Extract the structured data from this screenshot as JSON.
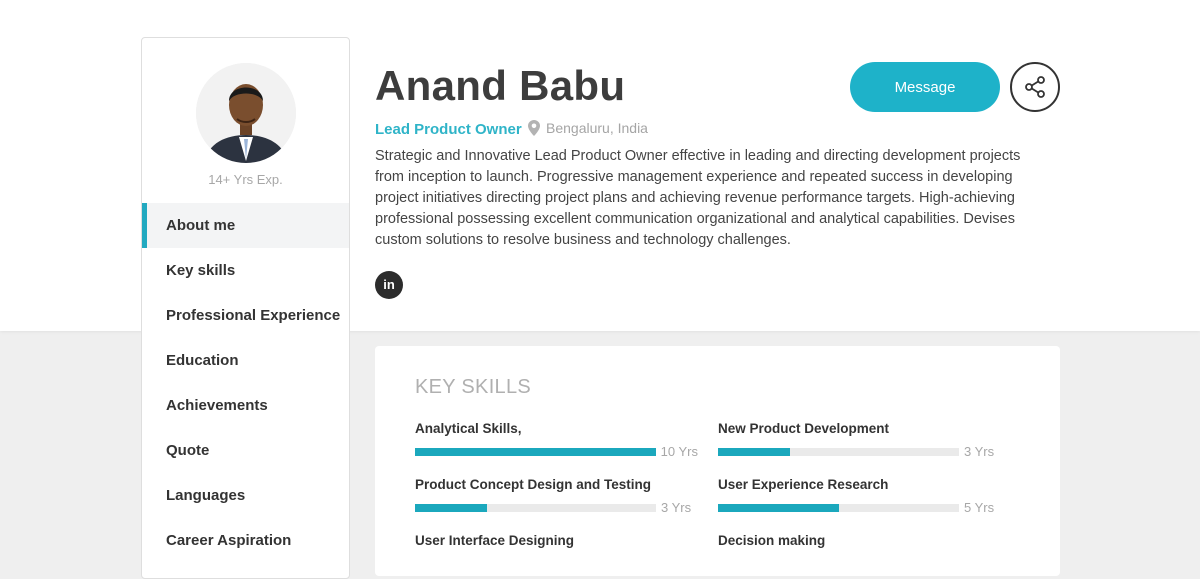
{
  "profile": {
    "name": "Anand Babu",
    "role": "Lead Product Owner",
    "location": "Bengaluru, India",
    "experience": "14+ Yrs Exp.",
    "bio": "Strategic and Innovative Lead Product Owner effective in leading and directing development projects from inception to launch. Progressive management experience and repeated success in developing project initiatives directing project plans and achieving revenue performance targets. High-achieving professional possessing excellent communication organizational and analytical capabilities. Devises custom solutions to resolve business and technology challenges.",
    "linkedin_label": "in"
  },
  "actions": {
    "message_label": "Message",
    "share_icon": "share-icon"
  },
  "sidebar": {
    "items": [
      {
        "label": "About me",
        "active": true
      },
      {
        "label": "Key skills",
        "active": false
      },
      {
        "label": "Professional Experience",
        "active": false
      },
      {
        "label": "Education",
        "active": false
      },
      {
        "label": "Achievements",
        "active": false
      },
      {
        "label": "Quote",
        "active": false
      },
      {
        "label": "Languages",
        "active": false
      },
      {
        "label": "Career Aspiration",
        "active": false
      }
    ]
  },
  "skills": {
    "title": "KEY SKILLS",
    "items": [
      {
        "name": "Analytical Skills,",
        "years": "10 Yrs",
        "level": 1.0
      },
      {
        "name": "New Product Development",
        "years": "3 Yrs",
        "level": 0.3
      },
      {
        "name": "Product Concept Design and Testing",
        "years": "3 Yrs",
        "level": 0.3
      },
      {
        "name": "User Experience Research",
        "years": "5 Yrs",
        "level": 0.5
      },
      {
        "name": "User Interface Designing",
        "years": "",
        "level": 0
      },
      {
        "name": "Decision making",
        "years": "",
        "level": 0
      }
    ]
  },
  "colors": {
    "accent": "#1eb2c9",
    "bar_fill": "#1ba8bd"
  }
}
